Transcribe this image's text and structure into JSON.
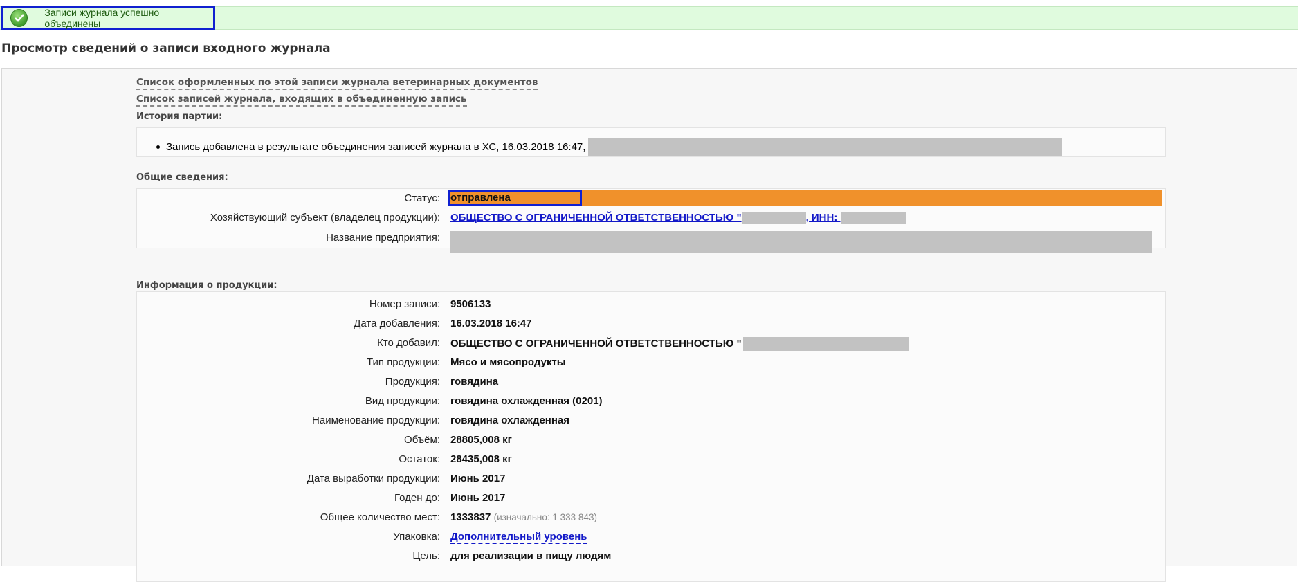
{
  "notice": {
    "text": "Записи журнала успешно объединены",
    "icon": "check-circle-icon"
  },
  "page_title": "Просмотр сведений о записи входного журнала",
  "links": {
    "vet_docs": "Список оформленных по этой записи журнала ветеринарных документов",
    "merged_entries": "Список записей журнала, входящих в объединенную запись"
  },
  "history": {
    "heading": "История партии:",
    "items": [
      "Запись добавлена в результате объединения записей журнала в ХС, 16.03.2018 16:47,"
    ]
  },
  "general": {
    "heading": "Общие сведения:",
    "status_label": "Статус:",
    "status_value": "отправлена",
    "owner_label": "Хозяйствующий субъект (владелец продукции):",
    "owner_value_prefix": "ОБЩЕСТВО С ОГРАНИЧЕННОЙ ОТВЕТСТВЕННОСТЬЮ \"",
    "owner_inn_label": ", ИНН: ",
    "owner_inn_prefix": "",
    "enterprise_label": "Название предприятия:"
  },
  "product": {
    "heading": "Информация о продукции:",
    "record_no_label": "Номер записи:",
    "record_no": "9506133",
    "added_label": "Дата добавления:",
    "added": "16.03.2018 16:47",
    "added_by_label": "Кто добавил:",
    "added_by": "ОБЩЕСТВО С ОГРАНИЧЕННОЙ ОТВЕТСТВЕННОСТЬЮ \"",
    "type_label": "Тип продукции:",
    "type": "Мясо и мясопродукты",
    "product_label": "Продукция:",
    "product": "говядина",
    "kind_label": "Вид продукции:",
    "kind": "говядина охлажденная (0201)",
    "name_label": "Наименование продукции:",
    "name": "говядина охлажденная",
    "volume_label": "Объём:",
    "volume": "28805,008 кг",
    "rest_label": "Остаток:",
    "rest": "28435,008 кг",
    "prod_date_label": "Дата выработки продукции:",
    "prod_date": "Июнь 2017",
    "expiry_label": "Годен до:",
    "expiry": "Июнь 2017",
    "places_label": "Общее количество мест:",
    "places": "1333837",
    "places_initial": "(изначально: 1 333 843)",
    "package_label": "Упаковка:",
    "package": "Дополнительный уровень",
    "purpose_label": "Цель:",
    "purpose": "для реализации в пищу людям"
  }
}
